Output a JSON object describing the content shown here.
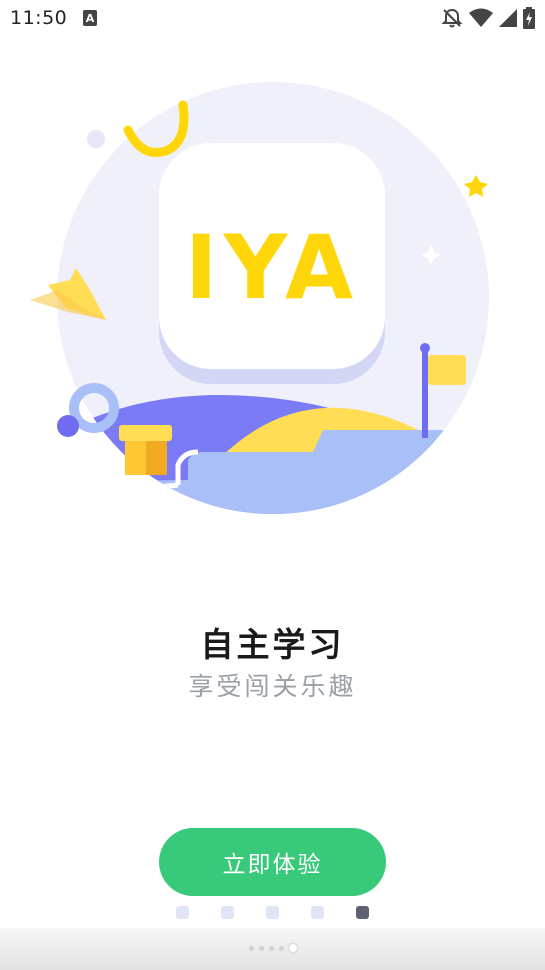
{
  "status_bar": {
    "time": "11:50",
    "icons": [
      "text-a-icon",
      "notifications-off-icon",
      "wifi-icon",
      "signal-icon",
      "battery-charging-icon"
    ]
  },
  "hero": {
    "logo_text": "IYA"
  },
  "slide": {
    "title": "自主学习",
    "subtitle": "享受闯关乐趣"
  },
  "cta": {
    "label": "立即体验"
  },
  "pager": {
    "count": 5,
    "active_index": 4
  },
  "nav_bar": {
    "page_count": 5,
    "active_index": 4
  },
  "colors": {
    "primary_green": "#39c97a",
    "logo_yellow": "#ffd60a",
    "circle_bg": "#f0f0fb",
    "hill_purple": "#7b7cf5",
    "hill_blue": "#a9bff7",
    "text_dark": "#1a1a1a",
    "text_gray": "#9aa0a8"
  }
}
